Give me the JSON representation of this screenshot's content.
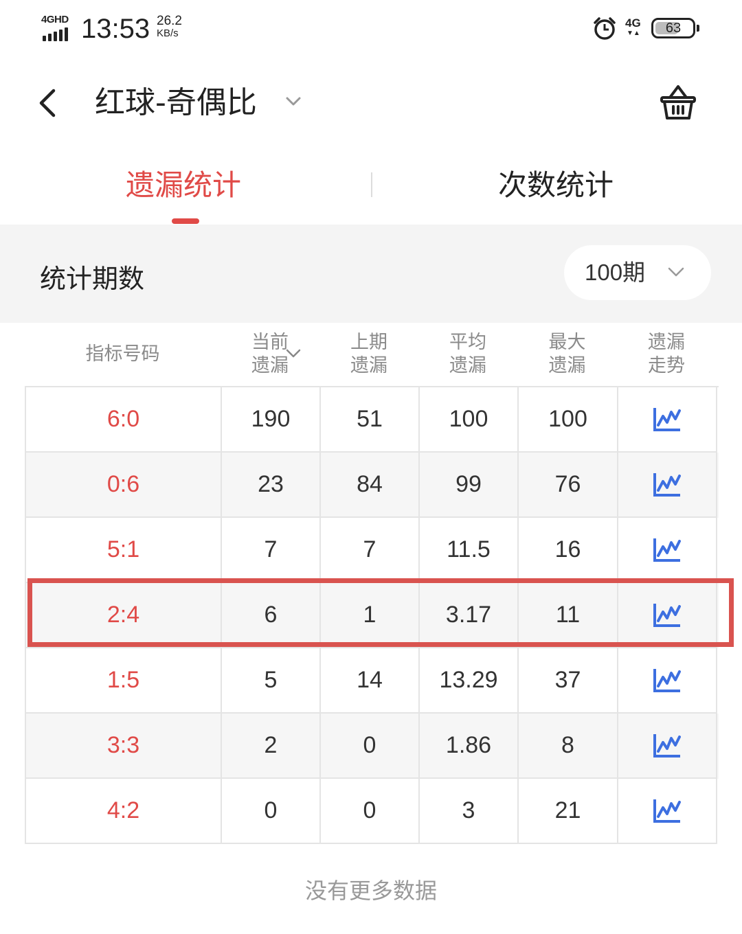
{
  "status_bar": {
    "network": "4GHD",
    "time": "13:53",
    "speed_value": "26.2",
    "speed_unit": "KB/s",
    "mobile_data": "4G",
    "battery": "63",
    "battery_level": 0.63
  },
  "header": {
    "title": "红球-奇偶比"
  },
  "tabs": [
    {
      "label": "遗漏统计",
      "active": true
    },
    {
      "label": "次数统计",
      "active": false
    }
  ],
  "period": {
    "label": "统计期数",
    "value": "100期"
  },
  "table": {
    "headers": [
      {
        "line1": "指标号码",
        "line2": ""
      },
      {
        "line1": "当前",
        "line2": "遗漏"
      },
      {
        "line1": "上期",
        "line2": "遗漏"
      },
      {
        "line1": "平均",
        "line2": "遗漏"
      },
      {
        "line1": "最大",
        "line2": "遗漏"
      },
      {
        "line1": "遗漏",
        "line2": "走势"
      }
    ],
    "rows": [
      {
        "code": "6:0",
        "current": "190",
        "last": "51",
        "avg": "100",
        "max": "100"
      },
      {
        "code": "0:6",
        "current": "23",
        "last": "84",
        "avg": "99",
        "max": "76"
      },
      {
        "code": "5:1",
        "current": "7",
        "last": "7",
        "avg": "11.5",
        "max": "16"
      },
      {
        "code": "2:4",
        "current": "6",
        "last": "1",
        "avg": "3.17",
        "max": "11"
      },
      {
        "code": "1:5",
        "current": "5",
        "last": "14",
        "avg": "13.29",
        "max": "37"
      },
      {
        "code": "3:3",
        "current": "2",
        "last": "0",
        "avg": "1.86",
        "max": "8"
      },
      {
        "code": "4:2",
        "current": "0",
        "last": "0",
        "avg": "3",
        "max": "21"
      }
    ],
    "highlighted_row": "2:4"
  },
  "footer": {
    "no_more": "没有更多数据"
  },
  "colors": {
    "accent": "#e04a47",
    "trend_icon": "#3d6fe0",
    "highlight_box": "#d9534f"
  },
  "icons": [
    "back-arrow-icon",
    "chevron-down-icon",
    "basket-icon",
    "trend-chart-icon",
    "alarm-clock-icon"
  ]
}
